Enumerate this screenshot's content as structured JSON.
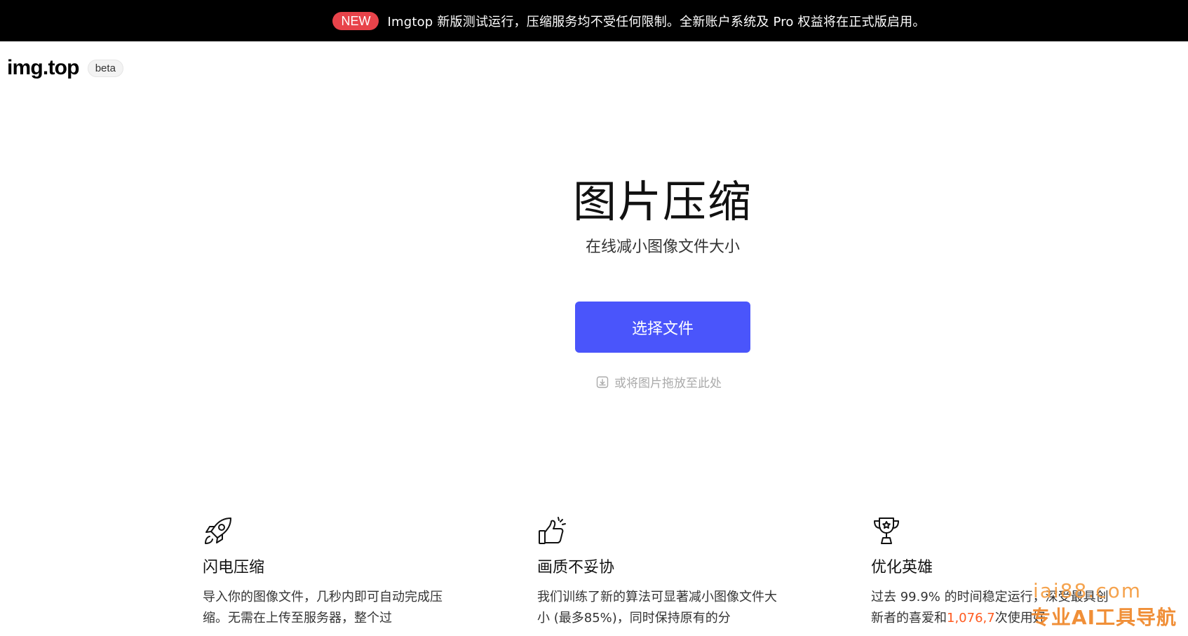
{
  "banner": {
    "badge": "NEW",
    "text": "Imgtop 新版测试运行，压缩服务均不受任何限制。全新账户系统及 Pro 权益将在正式版启用。"
  },
  "header": {
    "logo": "img.top",
    "beta": "beta"
  },
  "hero": {
    "title": "图片压缩",
    "subtitle": "在线减小图像文件大小",
    "select_button": "选择文件",
    "drop_hint": "或将图片拖放至此处"
  },
  "features": [
    {
      "icon": "rocket-icon",
      "title": "闪电压缩",
      "desc": "导入你的图像文件，几秒内即可自动完成压缩。无需在上传至服务器，整个过"
    },
    {
      "icon": "thumbs-up-icon",
      "title": "画质不妥协",
      "desc": "我们训练了新的算法可显著减小图像文件大小 (最多85%)，同时保持原有的分"
    },
    {
      "icon": "trophy-icon",
      "title": "优化英雄",
      "desc_before": "过去 99.9% 的时间稳定运行，深受最具创新者的喜爱和",
      "desc_highlight": "1,076,7",
      "desc_after": "次使用好"
    }
  ],
  "watermark": {
    "url": "iai88.com",
    "name": "专业AI工具导航"
  },
  "colors": {
    "banner_bg": "#000000",
    "badge_bg": "#e8434a",
    "primary_button": "#4a55fb",
    "highlight": "#ff5a1f",
    "watermark": "#f08a2e"
  }
}
